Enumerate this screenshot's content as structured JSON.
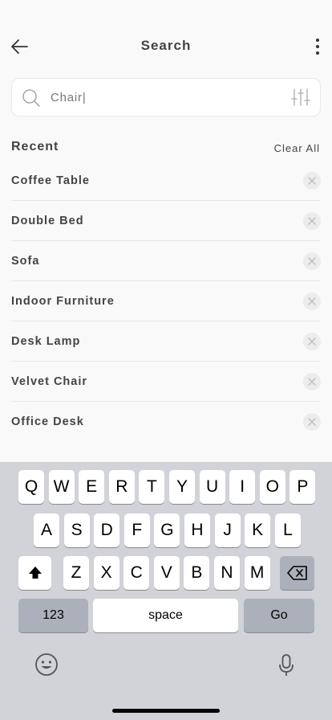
{
  "header": {
    "title": "Search"
  },
  "search": {
    "value": "Chair|",
    "placeholder": "Search"
  },
  "recent": {
    "title": "Recent",
    "clear_label": "Clear All",
    "items": [
      "Coffee Table",
      "Double Bed",
      "Sofa",
      "Indoor Furniture",
      "Desk Lamp",
      "Velvet Chair",
      "Office Desk"
    ]
  },
  "keyboard": {
    "row1": [
      "Q",
      "W",
      "E",
      "R",
      "T",
      "Y",
      "U",
      "I",
      "O",
      "P"
    ],
    "row2": [
      "A",
      "S",
      "D",
      "F",
      "G",
      "H",
      "J",
      "K",
      "L"
    ],
    "row3": [
      "Z",
      "X",
      "C",
      "V",
      "B",
      "N",
      "M"
    ],
    "numbers_label": "123",
    "space_label": "space",
    "go_label": "Go"
  },
  "icons": {
    "back": "arrow-left-icon",
    "more": "more-vertical-icon",
    "search": "search-icon",
    "filter": "sliders-icon",
    "remove": "close-icon",
    "shift": "shift-icon",
    "backspace": "backspace-icon",
    "emoji": "emoji-icon",
    "mic": "microphone-icon"
  }
}
